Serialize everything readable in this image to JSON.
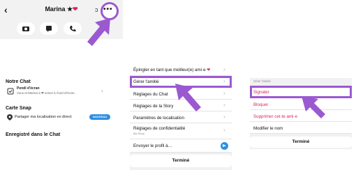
{
  "panel1": {
    "title": "Marina ★",
    "status": "‹",
    "more": "•••",
    "section_chat": "Notre Chat",
    "screenshot_title": "Pendi d'écran",
    "screenshot_sub": "Vous et Marina à ❤ venez lu fond d'écran.",
    "section_map": "Carte Snap",
    "share_location": "Partager ma localisation en direct",
    "live_badge": "NOUVEAU",
    "section_saved": "Enregistré dans le Chat"
  },
  "panel2": {
    "pin": "Épingler en tant que meilleur(e) ami·e",
    "manage": "Gérer l'amitié",
    "chat_settings": "Réglages du Chat",
    "story_settings": "Réglages de la Story",
    "location_settings": "Paramètres de localisation",
    "privacy_settings": "Réglages de confidentialité",
    "privacy_sub": "Ma Story",
    "send_profile": "Envoyer le profil à…",
    "done": "Terminé"
  },
  "panel3": {
    "header": "Gérer l'amitié",
    "report": "Signaler",
    "block": "Bloquer",
    "remove": "Supprimer cet·te ami·e",
    "edit_name": "Modifier le nom",
    "done": "Terminé"
  },
  "colors": {
    "accent": "#9b59d0",
    "danger": "#e0245e",
    "blue": "#2f8fe3"
  }
}
